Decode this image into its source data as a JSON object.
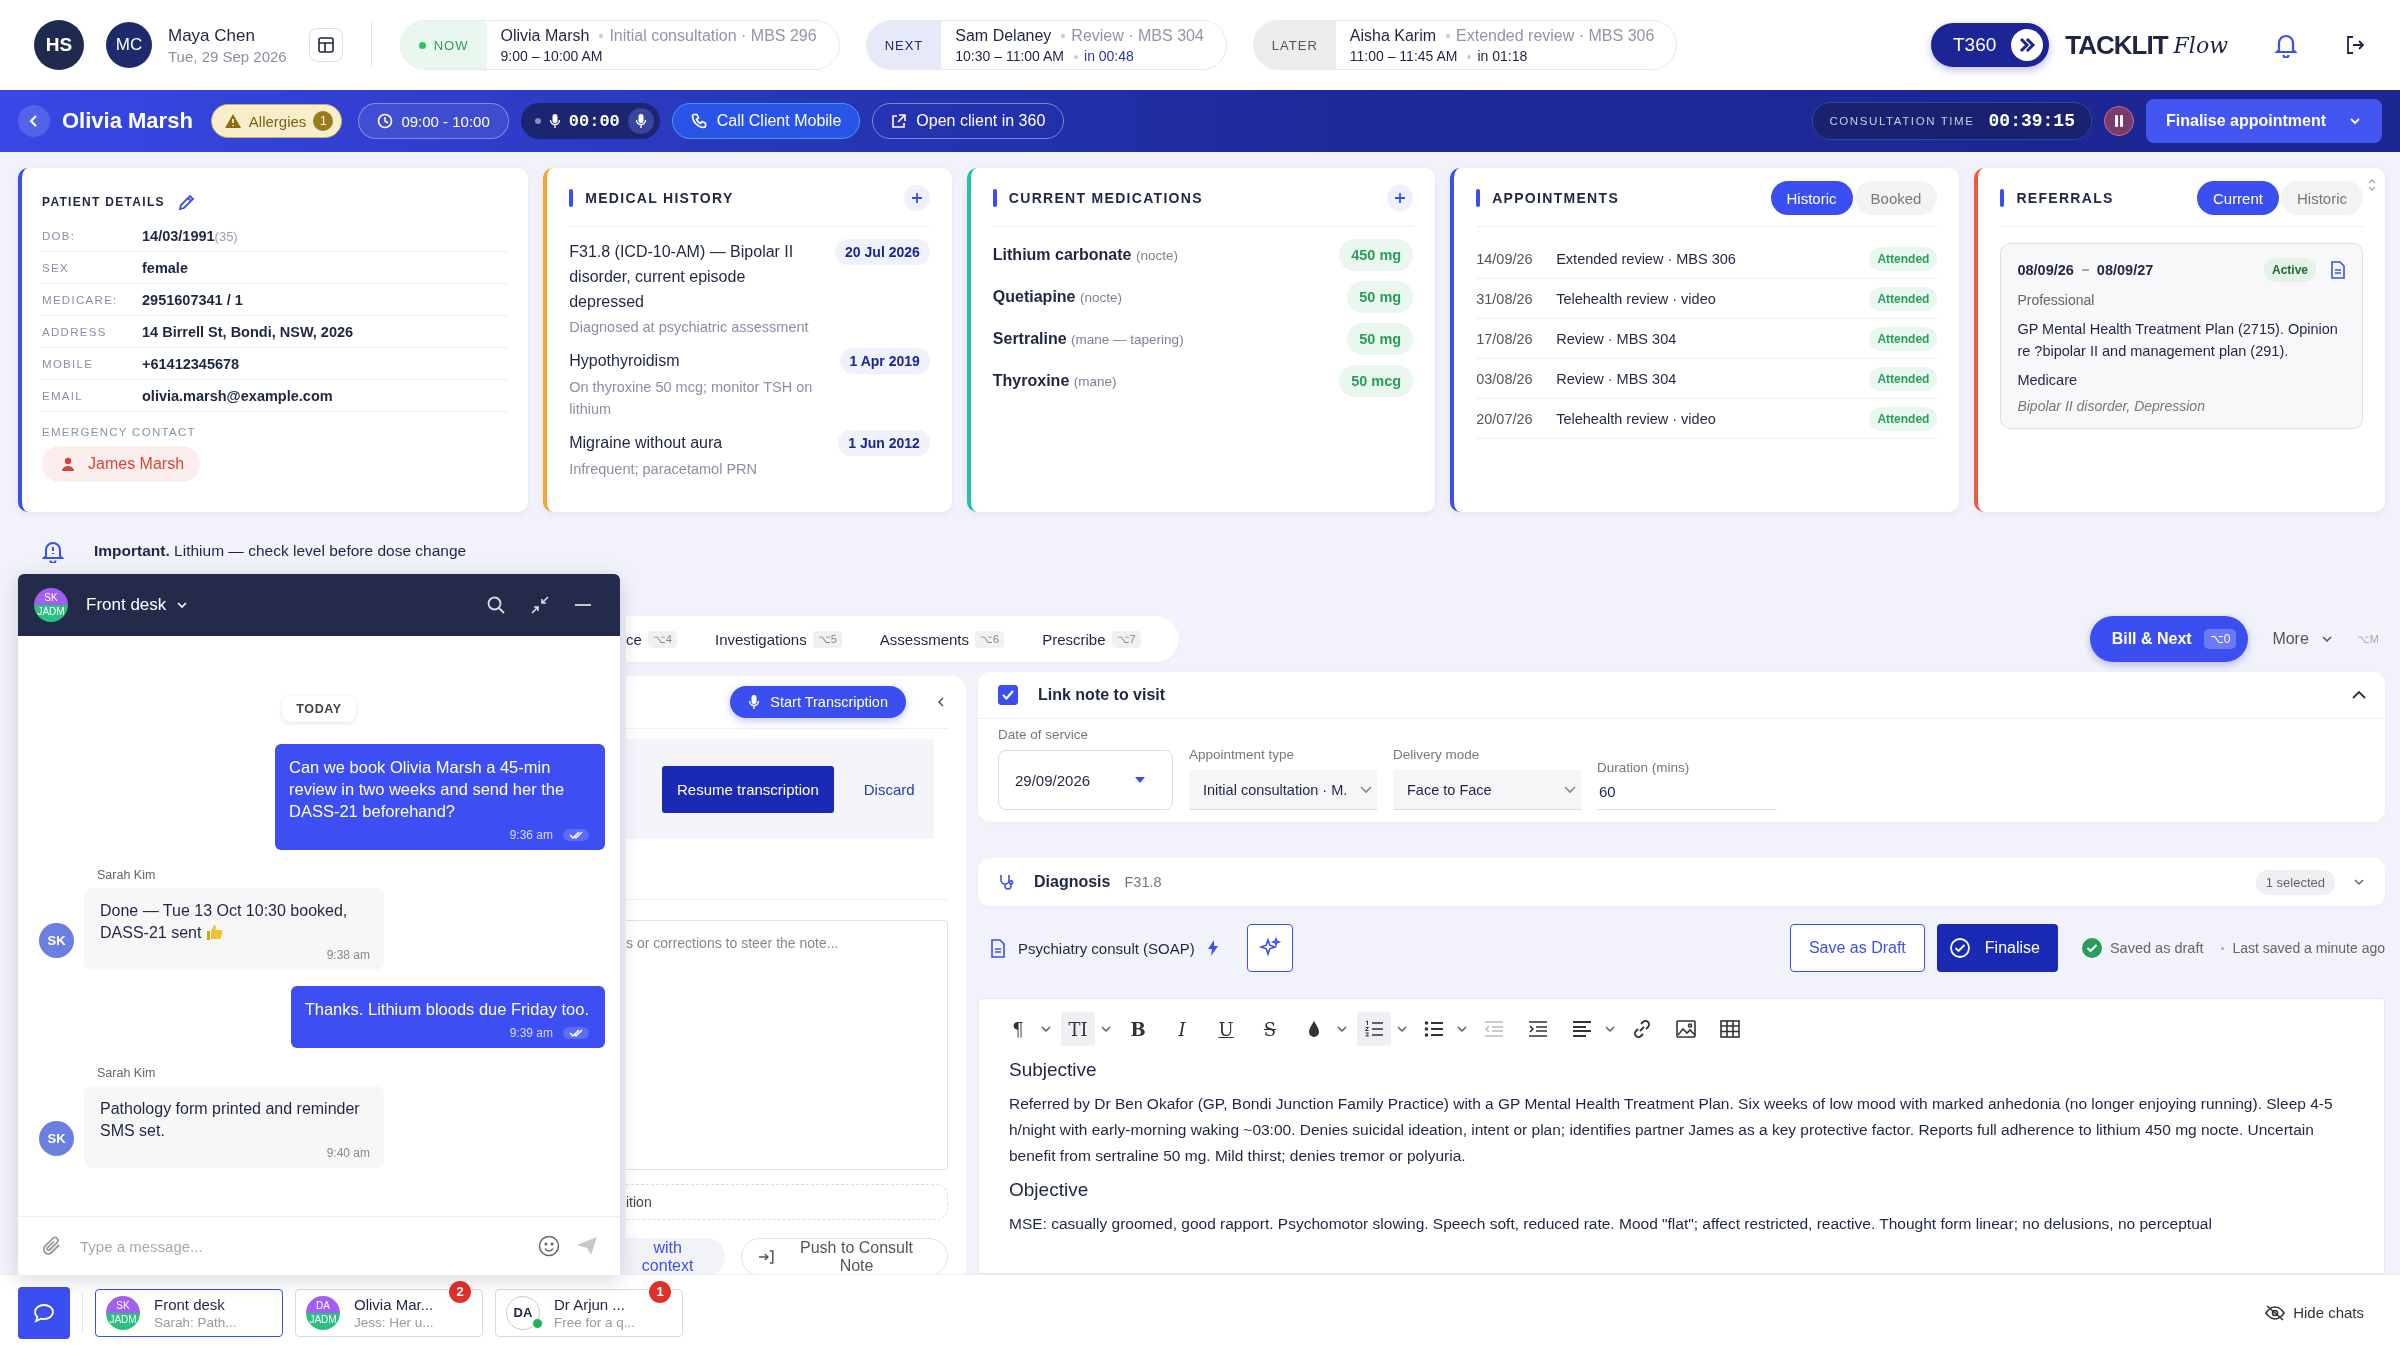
{
  "top_bar": {
    "user_initials": "HS",
    "clinician": {
      "initials": "MC",
      "name": "Maya Chen",
      "date": "Tue, 29 Sep 2026"
    },
    "queue": [
      {
        "kind": "now",
        "tag": "NOW",
        "name": "Olivia Marsh",
        "detail": "Initial consultation · MBS 296",
        "time": "9:00 – 10:00 AM"
      },
      {
        "kind": "next",
        "tag": "NEXT",
        "name": "Sam Delaney",
        "detail": "Review · MBS 304",
        "time": "10:30 – 11:00 AM",
        "eta": "in 00:48"
      },
      {
        "kind": "later",
        "tag": "LATER",
        "name": "Aisha Karim",
        "detail": "Extended review · MBS 306",
        "time": "11:00 – 11:45 AM",
        "eta": "in 01:18"
      }
    ],
    "brand": {
      "badge": "T360",
      "name": "TACKLIT",
      "script": "Flow"
    }
  },
  "patient_bar": {
    "name": "Olivia Marsh",
    "allergies": {
      "label": "Allergies",
      "count": "1"
    },
    "slot": "09:00 - 10:00",
    "recorder": "00:00",
    "call_button": "Call Client Mobile",
    "open_button": "Open client in 360",
    "consultation_time": {
      "label": "CONSULTATION TIME",
      "value": "00:39:15"
    },
    "finalise": "Finalise appointment"
  },
  "patient_details": {
    "title": "PATIENT DETAILS",
    "rows": [
      {
        "label": "DOB:",
        "value": "14/03/1991",
        "note": "(35)"
      },
      {
        "label": "SEX",
        "value": "female"
      },
      {
        "label": "MEDICARE:",
        "value": "2951607341 / 1"
      },
      {
        "label": "ADDRESS",
        "value": "14 Birrell St, Bondi, NSW, 2026"
      },
      {
        "label": "MOBILE",
        "value": "+61412345678"
      },
      {
        "label": "EMAIL",
        "value": "olivia.marsh@example.com"
      }
    ],
    "emergency_label": "EMERGENCY CONTACT",
    "emergency_contact": "James Marsh"
  },
  "medical_history": {
    "title": "MEDICAL HISTORY",
    "items": [
      {
        "condition": "F31.8 (ICD-10-AM) — Bipolar II disorder, current episode depressed",
        "date": "20 Jul 2026",
        "note": "Diagnosed at psychiatric assessment"
      },
      {
        "condition": "Hypothyroidism",
        "date": "1 Apr 2019",
        "note": "On thyroxine 50 mcg; monitor TSH on lithium"
      },
      {
        "condition": "Migraine without aura",
        "date": "1 Jun 2012",
        "note": "Infrequent; paracetamol PRN"
      }
    ]
  },
  "current_medications": {
    "title": "CURRENT MEDICATIONS",
    "items": [
      {
        "name": "Lithium carbonate",
        "timing": "(nocte)",
        "dose": "450 mg"
      },
      {
        "name": "Quetiapine",
        "timing": "(nocte)",
        "dose": "50 mg"
      },
      {
        "name": "Sertraline",
        "timing": "(mane — tapering)",
        "dose": "50 mg"
      },
      {
        "name": "Thyroxine",
        "timing": "(mane)",
        "dose": "50 mcg"
      }
    ]
  },
  "appointments": {
    "title": "APPOINTMENTS",
    "filters": [
      {
        "label": "Historic",
        "selected": true
      },
      {
        "label": "Booked",
        "selected": false
      }
    ],
    "rows": [
      {
        "date": "14/09/26",
        "type": "Extended review · MBS 306",
        "status": "Attended"
      },
      {
        "date": "31/08/26",
        "type": "Telehealth review · video",
        "status": "Attended"
      },
      {
        "date": "17/08/26",
        "type": "Review · MBS 304",
        "status": "Attended"
      },
      {
        "date": "03/08/26",
        "type": "Review · MBS 304",
        "status": "Attended"
      },
      {
        "date": "20/07/26",
        "type": "Telehealth review · video",
        "status": "Attended"
      }
    ]
  },
  "referrals": {
    "title": "REFERRALS",
    "filters": [
      {
        "label": "Current",
        "selected": true
      },
      {
        "label": "Historic",
        "selected": false
      }
    ],
    "items": [
      {
        "start": "08/09/26",
        "end": "08/09/27",
        "status": "Active",
        "category": "Professional",
        "description": "GP Mental Health Treatment Plan (2715). Opinion re ?bipolar II and management plan (291).",
        "funding": "Medicare",
        "diagnoses": "Bipolar II disorder, Depression"
      }
    ]
  },
  "alert": "**Important.** Lithium — check level before dose change",
  "tabs": [
    {
      "label": "ce",
      "shortcut": "⌥4",
      "selected": false
    },
    {
      "label": "Investigations",
      "shortcut": "⌥5",
      "selected": false
    },
    {
      "label": "Assessments",
      "shortcut": "⌥6",
      "selected": false
    },
    {
      "label": "Prescribe",
      "shortcut": "⌥7",
      "selected": false
    }
  ],
  "actions": {
    "bill_next": {
      "label": "Bill & Next",
      "shortcut": "⌥0"
    },
    "more": {
      "label": "More",
      "shortcut": "⌥M"
    }
  },
  "transcription": {
    "start": "Start Transcription",
    "resume": "Resume transcription",
    "discard": "Discard",
    "prompt_placeholder": "s or corrections to steer the note...",
    "dashed_field": "ition",
    "context_button": "with context",
    "push_button": "Push to Consult Note"
  },
  "visit": {
    "link_label": "Link note to visit",
    "linked": true,
    "date_label": "Date of service",
    "date": "29/09/2026",
    "appointment_type_label": "Appointment type",
    "appointment_type": "Initial consultation · M.",
    "delivery_label": "Delivery mode",
    "delivery": "Face to Face",
    "duration_label": "Duration (mins)",
    "duration": "60"
  },
  "diagnosis": {
    "label": "Diagnosis",
    "code": "F31.8",
    "count": "1 selected"
  },
  "note": {
    "template": "Psychiatry consult (SOAP)",
    "save_draft": "Save as Draft",
    "finalise": "Finalise",
    "status": "Saved as draft",
    "last_saved": "Last saved a minute ago",
    "toolbar": [
      {
        "kind": "glyph",
        "glyph": "¶",
        "menu": true,
        "active": false
      },
      {
        "kind": "glyph",
        "glyph": "TI",
        "menu": true,
        "active": true
      },
      {
        "kind": "glyph",
        "glyph": "B",
        "menu": false,
        "active": false
      },
      {
        "kind": "glyph",
        "glyph": "I",
        "menu": false,
        "active": false
      },
      {
        "kind": "glyph",
        "glyph": "U",
        "menu": false,
        "active": false
      },
      {
        "kind": "glyph",
        "glyph": "S",
        "menu": false,
        "active": false
      },
      {
        "kind": "color",
        "menu": true,
        "active": false
      },
      {
        "kind": "numbered-list",
        "menu": true,
        "active": true
      },
      {
        "kind": "bullet-list",
        "menu": true,
        "active": false
      },
      {
        "kind": "outdent",
        "menu": false,
        "active": false
      },
      {
        "kind": "indent",
        "menu": false,
        "active": false
      },
      {
        "kind": "align",
        "menu": true,
        "active": false
      },
      {
        "kind": "link",
        "menu": false,
        "active": false
      },
      {
        "kind": "image",
        "menu": false,
        "active": false
      },
      {
        "kind": "table",
        "menu": false,
        "active": false
      }
    ],
    "sections": [
      {
        "heading": "Subjective",
        "text": "Referred by Dr Ben Okafor (GP, Bondi Junction Family Practice) with a GP Mental Health Treatment Plan. Six weeks of low mood with marked anhedonia (no longer enjoying running). Sleep 4-5 h/night with early-morning waking ~03:00. Denies suicidal ideation, intent or plan; identifies partner James as a key protective factor. Reports full adherence to lithium 450 mg nocte. Uncertain benefit from sertraline 50 mg. Mild thirst; denies tremor or polyuria."
      },
      {
        "heading": "Objective",
        "text": "MSE: casually groomed, good rapport. Psychomotor slowing. Speech soft, reduced rate. Mood \"flat\"; affect restricted, reactive. Thought form linear; no delusions, no perceptual"
      }
    ]
  },
  "chat": {
    "avatar": [
      "SK",
      "JADM"
    ],
    "title": "Front desk",
    "day": "TODAY",
    "messages": [
      {
        "kind": "sent",
        "text": "Can we book Olivia Marsh a 45-min review in two weeks and send her the DASS-21 beforehand?",
        "time": "9:36 am",
        "read": true
      },
      {
        "kind": "received",
        "sender": "Sarah Kim",
        "initials": "SK",
        "text": "Done — Tue 13 Oct 10:30 booked, DASS-21 sent",
        "thumbs_up": true,
        "time": "9:38 am"
      },
      {
        "kind": "sent",
        "text": "Thanks. Lithium bloods due Friday too.",
        "time": "9:39 am",
        "read": true
      },
      {
        "kind": "received",
        "sender": "Sarah Kim",
        "initials": "SK",
        "text": "Pathology form printed and reminder SMS set.",
        "thumbs_up": false,
        "time": "9:40 am"
      }
    ],
    "composer_placeholder": "Type a message..."
  },
  "chat_tabs": [
    {
      "avatar": [
        "SK",
        "JADM"
      ],
      "title": "Front desk",
      "preview": "Sarah: Path...",
      "selected": true,
      "online": false
    },
    {
      "avatar": [
        "DA",
        "JADM"
      ],
      "title": "Olivia Mar...",
      "preview": "Jess: Her u...",
      "selected": false,
      "unread": "2",
      "online": false
    },
    {
      "avatar": [
        "DA"
      ],
      "title": "Dr Arjun ...",
      "preview": "Free for a q...",
      "selected": false,
      "unread": "1",
      "online": true
    }
  ],
  "hide_chats": "Hide chats"
}
